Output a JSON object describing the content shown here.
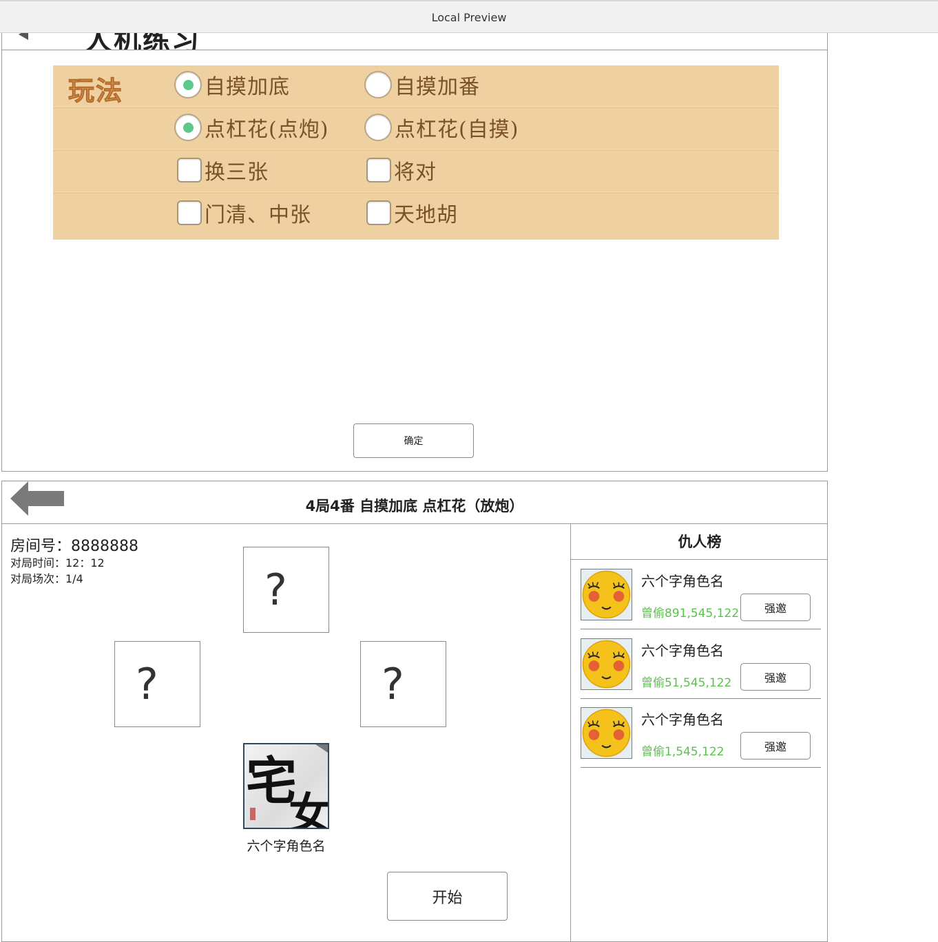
{
  "window": {
    "title": "Local Preview"
  },
  "setup_panel": {
    "title": "人机练习",
    "rules_label": "玩法",
    "options": [
      {
        "label": "自摸加底",
        "kind": "radio",
        "checked": true
      },
      {
        "label": "自摸加番",
        "kind": "radio",
        "checked": false
      },
      {
        "label": "点杠花(点炮)",
        "kind": "radio",
        "checked": true
      },
      {
        "label": "点杠花(自摸)",
        "kind": "radio",
        "checked": false
      },
      {
        "label": "换三张",
        "kind": "checkbox",
        "checked": false
      },
      {
        "label": "将对",
        "kind": "checkbox",
        "checked": false
      },
      {
        "label": "门清、中张",
        "kind": "checkbox",
        "checked": false
      },
      {
        "label": "天地胡",
        "kind": "checkbox",
        "checked": false
      }
    ],
    "confirm_label": "确定"
  },
  "room_panel": {
    "title": "4局4番 自摸加底 点杠花（放炮）",
    "room_number_text": "房间号：8888888",
    "match_time_text": "对局时间：12：12",
    "match_round_text": "对局场次：1/4",
    "seat_placeholder": "?",
    "me": {
      "avatar_char_1": "宅",
      "avatar_char_2": "女",
      "name": "六个字角色名"
    },
    "start_label": "开始",
    "enemy_board": {
      "title": "仇人榜",
      "entries": [
        {
          "name": "六个字角色名",
          "stolen": "曾偷891,545,122",
          "button": "强邀"
        },
        {
          "name": "六个字角色名",
          "stolen": "曾偷51,545,122",
          "button": "强邀"
        },
        {
          "name": "六个字角色名",
          "stolen": "曾偷1,545,122",
          "button": "强邀"
        }
      ]
    }
  },
  "icons": {
    "back": "back-arrow-icon",
    "avatar_emoji": "blushing-face-icon"
  },
  "colors": {
    "rules_bg": "#efd0a0",
    "radio_dot": "#5ec88c",
    "option_text": "#7a5229",
    "stolen_text": "#5ac24c"
  }
}
